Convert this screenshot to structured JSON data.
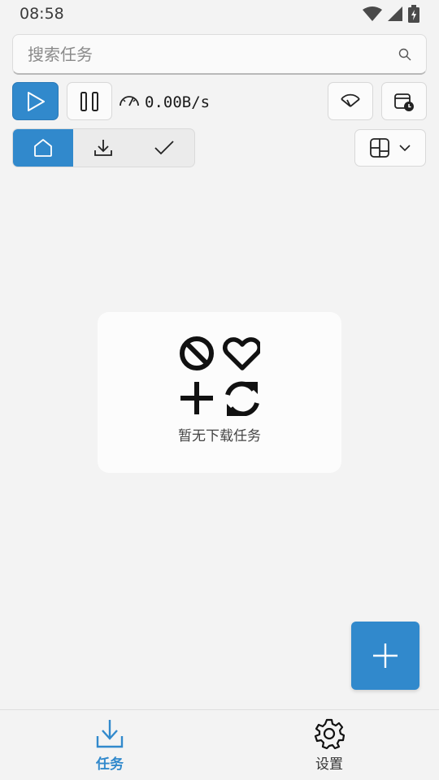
{
  "status_bar": {
    "time": "08:58"
  },
  "search": {
    "placeholder": "搜索任务"
  },
  "toolbar": {
    "speed": "0.00B/s"
  },
  "empty_state": {
    "message": "暂无下载任务"
  },
  "bottom_nav": {
    "items": [
      {
        "label": "任务",
        "icon": "download-icon",
        "active": true
      },
      {
        "label": "设置",
        "icon": "gear-icon",
        "active": false
      }
    ]
  },
  "colors": {
    "accent": "#3189cc",
    "background": "#f3f3f3"
  }
}
